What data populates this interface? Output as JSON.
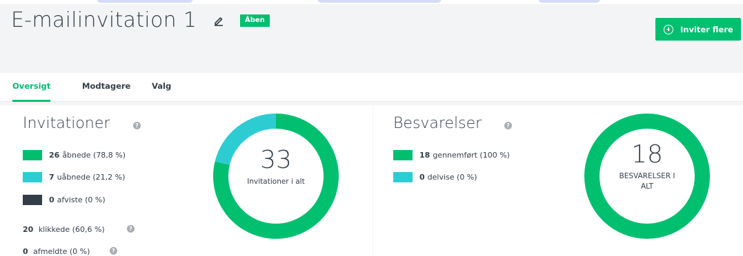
{
  "header": {
    "title": "E-mailinvitation 1",
    "status_badge": "Åben",
    "invite_button_label": "Inviter flere"
  },
  "tabs": [
    {
      "label": "Oversigt",
      "active": true
    },
    {
      "label": "Modtagere",
      "active": false
    },
    {
      "label": "Valg",
      "active": false
    }
  ],
  "invitations": {
    "title": "Invitationer",
    "legend": [
      {
        "count": "26",
        "label": "åbnede (78,8 %)",
        "color": "#00bf6f"
      },
      {
        "count": "7",
        "label": "uåbnede (21,2 %)",
        "color": "#2dccd3"
      },
      {
        "count": "0",
        "label": "afviste (0 %)",
        "color": "#333e48"
      }
    ],
    "clicked": {
      "count": "20",
      "label": "klikkede (60,6 %)"
    },
    "unsubscribed": {
      "count": "0",
      "label": "afmeldte (0 %)"
    },
    "total": "33",
    "total_caption": "Invitationer i alt",
    "donut": [
      {
        "value": 78.8,
        "color": "#00bf6f"
      },
      {
        "value": 21.2,
        "color": "#2dccd3"
      }
    ]
  },
  "responses": {
    "title": "Besvarelser",
    "legend": [
      {
        "count": "18",
        "label": "gennemført (100 %)",
        "color": "#00bf6f"
      },
      {
        "count": "0",
        "label": "delvise (0 %)",
        "color": "#2dccd3"
      }
    ],
    "total": "18",
    "total_caption_line1": "BESVARELSER I",
    "total_caption_line2": "ALT",
    "donut": [
      {
        "value": 100,
        "color": "#00bf6f"
      }
    ]
  },
  "icons": {
    "edit": "pencil-icon",
    "help": "question-icon",
    "invite": "plus-circle-icon"
  }
}
